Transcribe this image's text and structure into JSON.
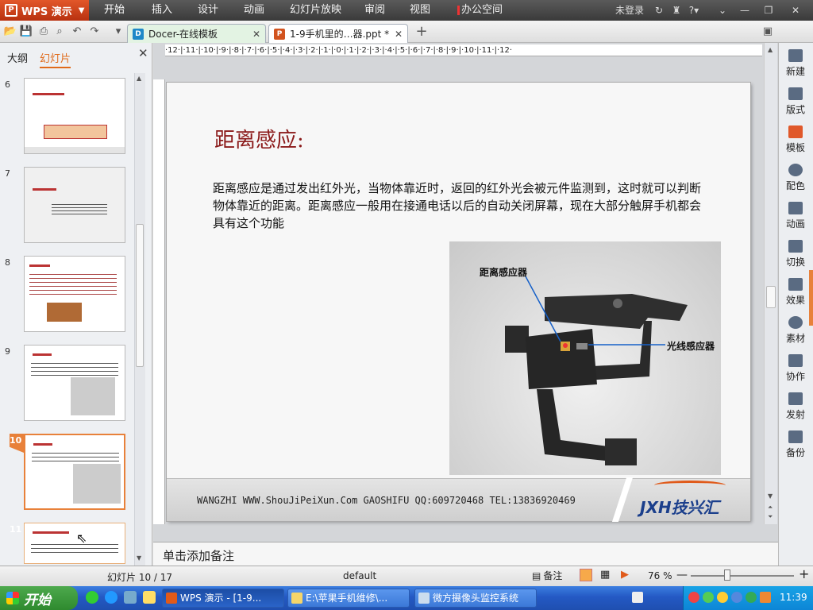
{
  "titlebar": {
    "app_name": "WPS 演示",
    "menus": [
      "开始",
      "插入",
      "设计",
      "动画",
      "幻灯片放映",
      "审阅",
      "视图",
      "办公空间"
    ],
    "user_label": "未登录"
  },
  "tabs": [
    {
      "label": "Docer-在线模板",
      "icon": "docer-icon"
    },
    {
      "label": "1-9手机里的…器.ppt *",
      "icon": "ppt-file-icon"
    }
  ],
  "left_panel": {
    "tab_outline": "大纲",
    "tab_slides": "幻灯片",
    "thumbnails": [
      {
        "num": "6"
      },
      {
        "num": "7"
      },
      {
        "num": "8"
      },
      {
        "num": "9"
      },
      {
        "num": "10",
        "selected": true
      },
      {
        "num": "11"
      }
    ]
  },
  "ruler": {
    "labels": "·12·|·11·|·10·|·9·|·8·|·7·|·6·|·5·|·4·|·3·|·2·|·1·|·0·|·1·|·2·|·3·|·4·|·5·|·6·|·7·|·8·|·9·|·10·|·11·|·12·"
  },
  "slide": {
    "title": "距离感应:",
    "body": "距离感应是通过发出红外光，当物体靠近时，返回的红外光会被元件监测到，这时就可以判断物体靠近的距离。距离感应一般用在接通电话以后的自动关闭屏幕，现在大部分触屏手机都会具有这个功能",
    "photo_label_1": "距离感应器",
    "photo_label_2": "光线感应器",
    "footer": "WANGZHI WWW.ShouJiPeiXun.Com   GAOSHIFU QQ:609720468 TEL:13836920469",
    "logo_text": "JXH技兴汇"
  },
  "notes_placeholder": "单击添加备注",
  "right_pane": [
    "新建",
    "版式",
    "模板",
    "配色",
    "动画",
    "切换",
    "效果",
    "素材",
    "协作",
    "发射",
    "备份"
  ],
  "status": {
    "slide_counter": "幻灯片 10 / 17",
    "template": "default",
    "notes_button": "备注",
    "zoom": "76 %"
  },
  "taskbar": {
    "start": "开始",
    "tasks": [
      "WPS 演示 - [1-9...",
      "E:\\苹果手机维修\\...",
      "微方摄像头监控系统"
    ],
    "clock": "11:39"
  },
  "colors": {
    "accent": "#e8813a",
    "title_red": "#8b1a1a",
    "logo_blue": "#1b3f8c"
  }
}
